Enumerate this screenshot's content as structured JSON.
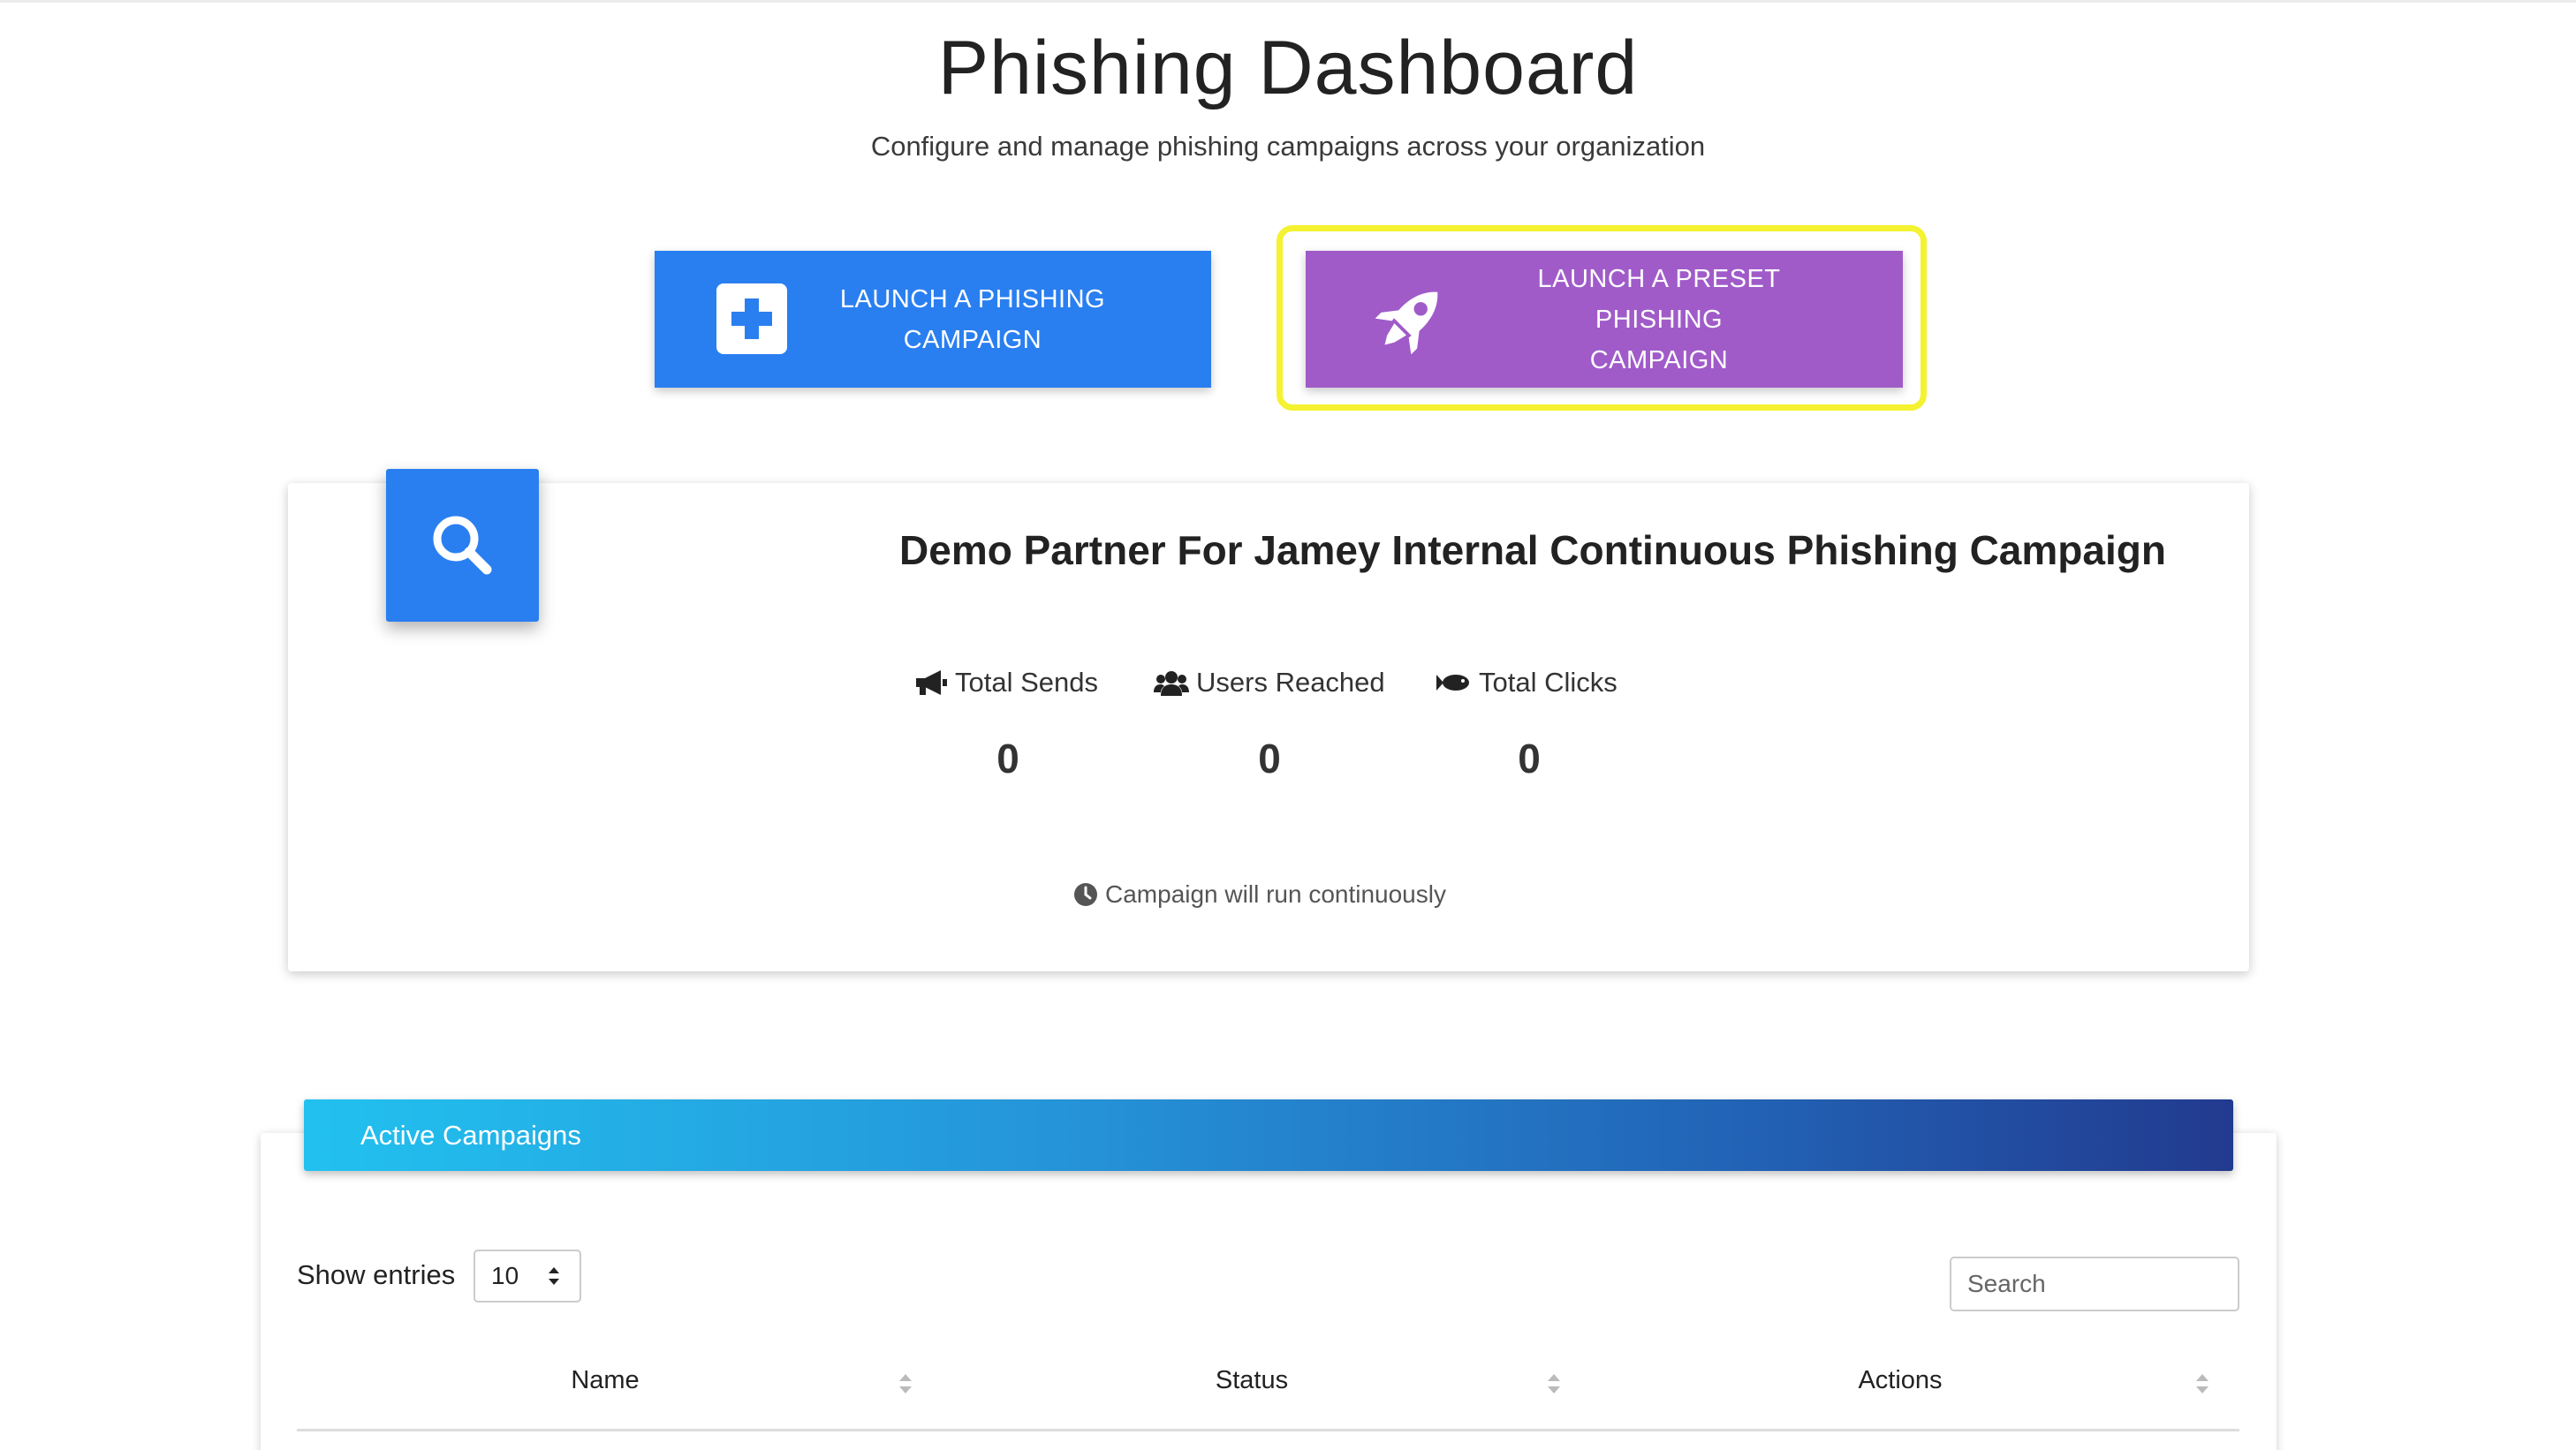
{
  "header": {
    "title": "Phishing Dashboard",
    "subtitle": "Configure and manage phishing campaigns across your organization"
  },
  "actions": {
    "launch_campaign": {
      "label": "LAUNCH A PHISHING\nCAMPAIGN",
      "icon": "plus-square-icon",
      "color": "#2a7ff0"
    },
    "launch_preset": {
      "label": "LAUNCH A PRESET PHISHING\nCAMPAIGN",
      "icon": "rocket-icon",
      "color": "#a05bc9",
      "highlight_color": "#f4f231"
    }
  },
  "campaign_card": {
    "icon": "search-icon",
    "title": "Demo Partner For Jamey Internal Continuous Phishing Campaign",
    "stats": [
      {
        "label": "Total Sends",
        "icon": "megaphone-icon",
        "value": "0"
      },
      {
        "label": "Users Reached",
        "icon": "users-icon",
        "value": "0"
      },
      {
        "label": "Total Clicks",
        "icon": "fish-icon",
        "value": "0"
      }
    ],
    "run_note": "Campaign will run continuously",
    "run_note_icon": "clock-icon"
  },
  "active_campaigns": {
    "header": "Active Campaigns",
    "show_entries_label": "Show entries",
    "entries_value": "10",
    "search_placeholder": "Search",
    "columns": [
      "Name",
      "Status",
      "Actions"
    ]
  }
}
